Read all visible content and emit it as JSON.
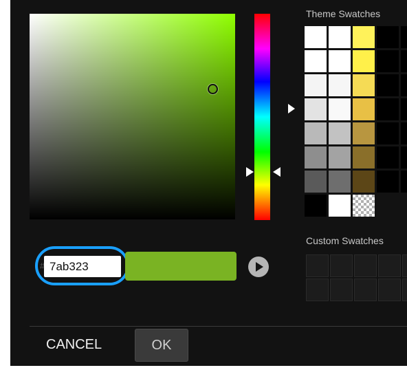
{
  "picker": {
    "hue_color": "#8fff00",
    "selected_color": "#7ab323"
  },
  "hex": {
    "value": "7ab323",
    "hash": "#"
  },
  "theme_swatches": {
    "label": "Theme Swatches",
    "colors": [
      "#ffffff",
      "#ffffff",
      "#fff25a",
      "#000000",
      "#000000",
      "#ffffff",
      "#ffffff",
      "#fff04a",
      "#000000",
      "#000000",
      "#f4f4f4",
      "#f6f6f6",
      "#f5db55",
      "#000000",
      "#000000",
      "#e3e3e3",
      "#f9f9f9",
      "#e8c045",
      "#000000",
      "#000000",
      "#b9b9b9",
      "#c2c2c2",
      "#b89640",
      "#000000",
      "#000000",
      "#8e8e8e",
      "#a3a3a3",
      "#8a6f2a",
      "#000000",
      "#000000",
      "#5a5a5a",
      "#6e6e6e",
      "#5c4617",
      "#000000",
      "#000000",
      "#000000",
      "#ffffff",
      "checker"
    ]
  },
  "custom_swatches": {
    "label": "Custom Swatches",
    "count": 10
  },
  "footer": {
    "cancel_label": "CANCEL",
    "ok_label": "OK"
  }
}
